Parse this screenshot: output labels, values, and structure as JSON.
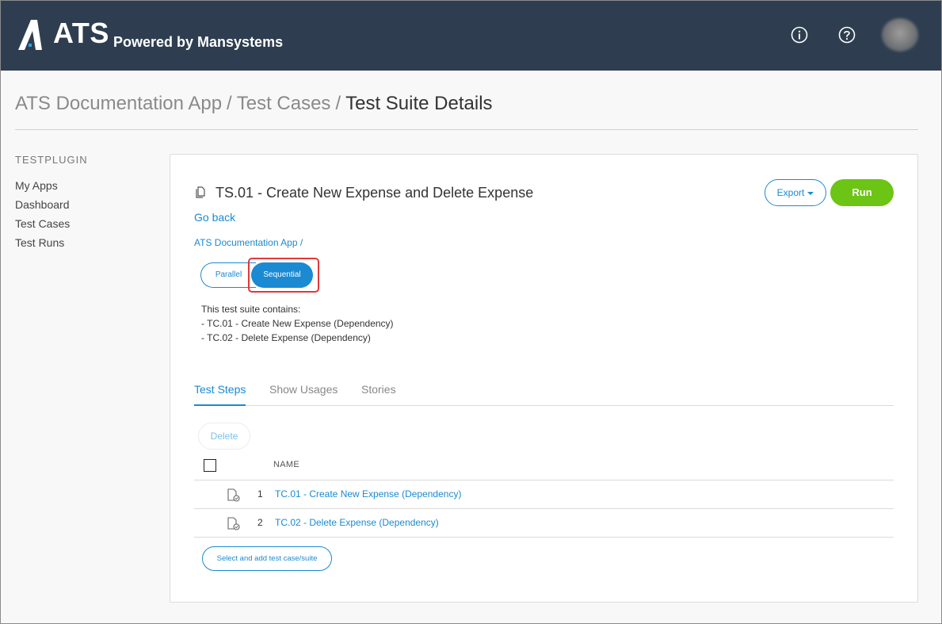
{
  "header": {
    "logo_text": "ATS",
    "logo_subtitle": "Powered by Mansystems",
    "icons": [
      "info-icon",
      "help-icon",
      "avatar"
    ]
  },
  "page_breadcrumb": {
    "app": "ATS Documentation App",
    "section": "Test Cases",
    "current": "Test Suite Details",
    "separator": "/"
  },
  "sidebar": {
    "heading": "TESTPLUGIN",
    "items": [
      {
        "label": "My Apps"
      },
      {
        "label": "Dashboard"
      },
      {
        "label": "Test Cases"
      },
      {
        "label": "Test Runs"
      }
    ]
  },
  "suite": {
    "title": "TS.01 - Create New Expense and Delete Expense",
    "export_label": "Export",
    "run_label": "Run",
    "go_back": "Go back",
    "app_crumb": "ATS Documentation App",
    "app_crumb_sep": "/",
    "mode_options": {
      "parallel": "Parallel",
      "sequential": "Sequential"
    },
    "selected_mode": "Sequential",
    "description_lines": [
      "This test suite contains:",
      "- TC.01 - Create New Expense (Dependency)",
      "- TC.02 - Delete Expense (Dependency)"
    ]
  },
  "tabs": [
    {
      "label": "Test Steps",
      "active": true
    },
    {
      "label": "Show Usages",
      "active": false
    },
    {
      "label": "Stories",
      "active": false
    }
  ],
  "steps_table": {
    "delete_label": "Delete",
    "column_name": "NAME",
    "rows": [
      {
        "num": "1",
        "name": "TC.01 - Create New Expense (Dependency)"
      },
      {
        "num": "2",
        "name": "TC.02 - Delete Expense (Dependency)"
      }
    ],
    "add_label": "Select and add test case/suite"
  },
  "colors": {
    "header_bg": "#2e3e50",
    "accent": "#1b8ad2",
    "run_green": "#6cc414",
    "highlight_red": "#e23838"
  }
}
